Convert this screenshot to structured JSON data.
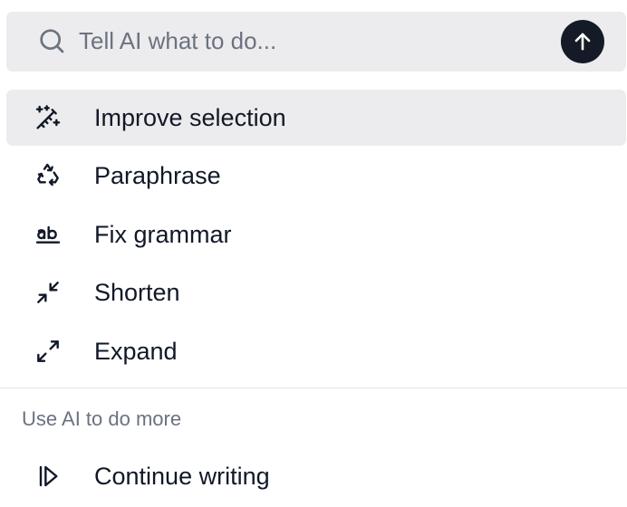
{
  "prompt": {
    "placeholder": "Tell AI what to do...",
    "value": "",
    "search_icon": "search-icon",
    "submit_icon": "arrow-up-icon"
  },
  "menu": {
    "items": [
      {
        "label": "Improve selection",
        "icon": "magic-wand-icon",
        "active": true
      },
      {
        "label": "Paraphrase",
        "icon": "recycle-icon",
        "active": false
      },
      {
        "label": "Fix grammar",
        "icon": "spellcheck-icon",
        "active": false
      },
      {
        "label": "Shorten",
        "icon": "minimize-icon",
        "active": false
      },
      {
        "label": "Expand",
        "icon": "maximize-icon",
        "active": false
      }
    ]
  },
  "more_section": {
    "title": "Use AI to do more",
    "items": [
      {
        "label": "Continue writing",
        "icon": "continue-icon"
      }
    ]
  },
  "colors": {
    "highlight": "#ececee",
    "submit_button": "#141b26",
    "text": "#111827",
    "muted_text": "#6b7280"
  }
}
